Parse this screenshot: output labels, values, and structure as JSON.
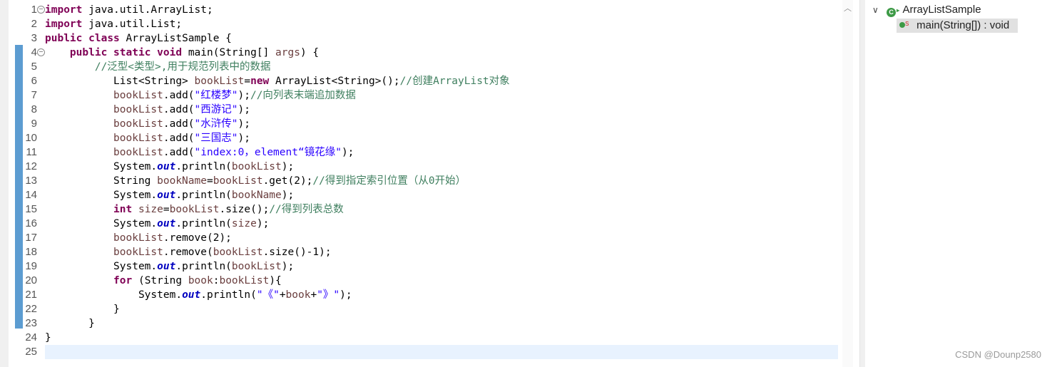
{
  "editor": {
    "lines": [
      {
        "num": "1",
        "fold": "−",
        "tokens": [
          {
            "t": "import",
            "c": "kw"
          },
          {
            "t": " java.util.ArrayList;"
          }
        ]
      },
      {
        "num": "2",
        "tokens": [
          {
            "t": "import",
            "c": "kw"
          },
          {
            "t": " java.util.List;"
          }
        ]
      },
      {
        "num": "3",
        "tokens": [
          {
            "t": "public",
            "c": "kw"
          },
          {
            "t": " "
          },
          {
            "t": "class",
            "c": "kw"
          },
          {
            "t": " ArrayListSample {"
          }
        ]
      },
      {
        "num": "4",
        "fold": "−",
        "tokens": [
          {
            "t": "    "
          },
          {
            "t": "public",
            "c": "kw"
          },
          {
            "t": " "
          },
          {
            "t": "static",
            "c": "kw"
          },
          {
            "t": " "
          },
          {
            "t": "void",
            "c": "kw"
          },
          {
            "t": " main(String[] "
          },
          {
            "t": "args",
            "c": "param"
          },
          {
            "t": ") {"
          }
        ]
      },
      {
        "num": "5",
        "tokens": [
          {
            "t": "        "
          },
          {
            "t": "//泛型<类型>,用于规范列表中的数据",
            "c": "cmt"
          }
        ]
      },
      {
        "num": "6",
        "tokens": [
          {
            "t": "           List<String> "
          },
          {
            "t": "bookList",
            "c": "var"
          },
          {
            "t": "="
          },
          {
            "t": "new",
            "c": "kw"
          },
          {
            "t": " ArrayList<String>();"
          },
          {
            "t": "//创建ArrayList对象",
            "c": "cmt"
          }
        ]
      },
      {
        "num": "7",
        "tokens": [
          {
            "t": "           "
          },
          {
            "t": "bookList",
            "c": "var"
          },
          {
            "t": ".add("
          },
          {
            "t": "\"红楼梦\"",
            "c": "str"
          },
          {
            "t": ");"
          },
          {
            "t": "//向列表末端追加数据",
            "c": "cmt"
          }
        ]
      },
      {
        "num": "8",
        "tokens": [
          {
            "t": "           "
          },
          {
            "t": "bookList",
            "c": "var"
          },
          {
            "t": ".add("
          },
          {
            "t": "\"西游记\"",
            "c": "str"
          },
          {
            "t": ");"
          }
        ]
      },
      {
        "num": "9",
        "tokens": [
          {
            "t": "           "
          },
          {
            "t": "bookList",
            "c": "var"
          },
          {
            "t": ".add("
          },
          {
            "t": "\"水浒传\"",
            "c": "str"
          },
          {
            "t": ");"
          }
        ]
      },
      {
        "num": "10",
        "tokens": [
          {
            "t": "           "
          },
          {
            "t": "bookList",
            "c": "var"
          },
          {
            "t": ".add("
          },
          {
            "t": "\"三国志\"",
            "c": "str"
          },
          {
            "t": ");"
          }
        ]
      },
      {
        "num": "11",
        "tokens": [
          {
            "t": "           "
          },
          {
            "t": "bookList",
            "c": "var"
          },
          {
            "t": ".add("
          },
          {
            "t": "\"index:0，element“镜花缘\"",
            "c": "str"
          },
          {
            "t": ");"
          }
        ]
      },
      {
        "num": "12",
        "tokens": [
          {
            "t": "           System."
          },
          {
            "t": "out",
            "c": "fld"
          },
          {
            "t": ".println("
          },
          {
            "t": "bookList",
            "c": "var"
          },
          {
            "t": ");"
          }
        ]
      },
      {
        "num": "13",
        "tokens": [
          {
            "t": "           String "
          },
          {
            "t": "bookName",
            "c": "var"
          },
          {
            "t": "="
          },
          {
            "t": "bookList",
            "c": "var"
          },
          {
            "t": ".get(2);"
          },
          {
            "t": "//得到指定索引位置（从0开始）",
            "c": "cmt"
          }
        ]
      },
      {
        "num": "14",
        "tokens": [
          {
            "t": "           System."
          },
          {
            "t": "out",
            "c": "fld"
          },
          {
            "t": ".println("
          },
          {
            "t": "bookName",
            "c": "var"
          },
          {
            "t": ");"
          }
        ]
      },
      {
        "num": "15",
        "tokens": [
          {
            "t": "           "
          },
          {
            "t": "int",
            "c": "kw"
          },
          {
            "t": " "
          },
          {
            "t": "size",
            "c": "var"
          },
          {
            "t": "="
          },
          {
            "t": "bookList",
            "c": "var"
          },
          {
            "t": ".size();"
          },
          {
            "t": "//得到列表总数",
            "c": "cmt"
          }
        ]
      },
      {
        "num": "16",
        "tokens": [
          {
            "t": "           System."
          },
          {
            "t": "out",
            "c": "fld"
          },
          {
            "t": ".println("
          },
          {
            "t": "size",
            "c": "var"
          },
          {
            "t": ");"
          }
        ]
      },
      {
        "num": "17",
        "tokens": [
          {
            "t": "           "
          },
          {
            "t": "bookList",
            "c": "var"
          },
          {
            "t": ".remove(2);"
          }
        ]
      },
      {
        "num": "18",
        "tokens": [
          {
            "t": "           "
          },
          {
            "t": "bookList",
            "c": "var"
          },
          {
            "t": ".remove("
          },
          {
            "t": "bookList",
            "c": "var"
          },
          {
            "t": ".size()-1);"
          }
        ]
      },
      {
        "num": "19",
        "tokens": [
          {
            "t": "           System."
          },
          {
            "t": "out",
            "c": "fld"
          },
          {
            "t": ".println("
          },
          {
            "t": "bookList",
            "c": "var"
          },
          {
            "t": ");"
          }
        ]
      },
      {
        "num": "20",
        "tokens": [
          {
            "t": "           "
          },
          {
            "t": "for",
            "c": "kw"
          },
          {
            "t": " (String "
          },
          {
            "t": "book",
            "c": "var"
          },
          {
            "t": ":"
          },
          {
            "t": "bookList",
            "c": "var"
          },
          {
            "t": "){"
          }
        ]
      },
      {
        "num": "21",
        "tokens": [
          {
            "t": "               System."
          },
          {
            "t": "out",
            "c": "fld"
          },
          {
            "t": ".println("
          },
          {
            "t": "\"《\"",
            "c": "str"
          },
          {
            "t": "+"
          },
          {
            "t": "book",
            "c": "var"
          },
          {
            "t": "+"
          },
          {
            "t": "\"》\"",
            "c": "str"
          },
          {
            "t": ");"
          }
        ]
      },
      {
        "num": "22",
        "tokens": [
          {
            "t": "           }"
          }
        ]
      },
      {
        "num": "23",
        "tokens": [
          {
            "t": "       }"
          }
        ]
      },
      {
        "num": "24",
        "tokens": [
          {
            "t": "}"
          }
        ]
      },
      {
        "num": "25",
        "tokens": [],
        "current": true
      }
    ]
  },
  "outline": {
    "class_name": "ArrayListSample",
    "twisty": "∨",
    "class_icon": "class-icon",
    "method_label": "main(String[]) : void",
    "method_icon": "public-method-icon",
    "static_marker": "S"
  },
  "scrollbar": {
    "up_arrow": "︿"
  },
  "watermark": "CSDN @Dounp2580"
}
